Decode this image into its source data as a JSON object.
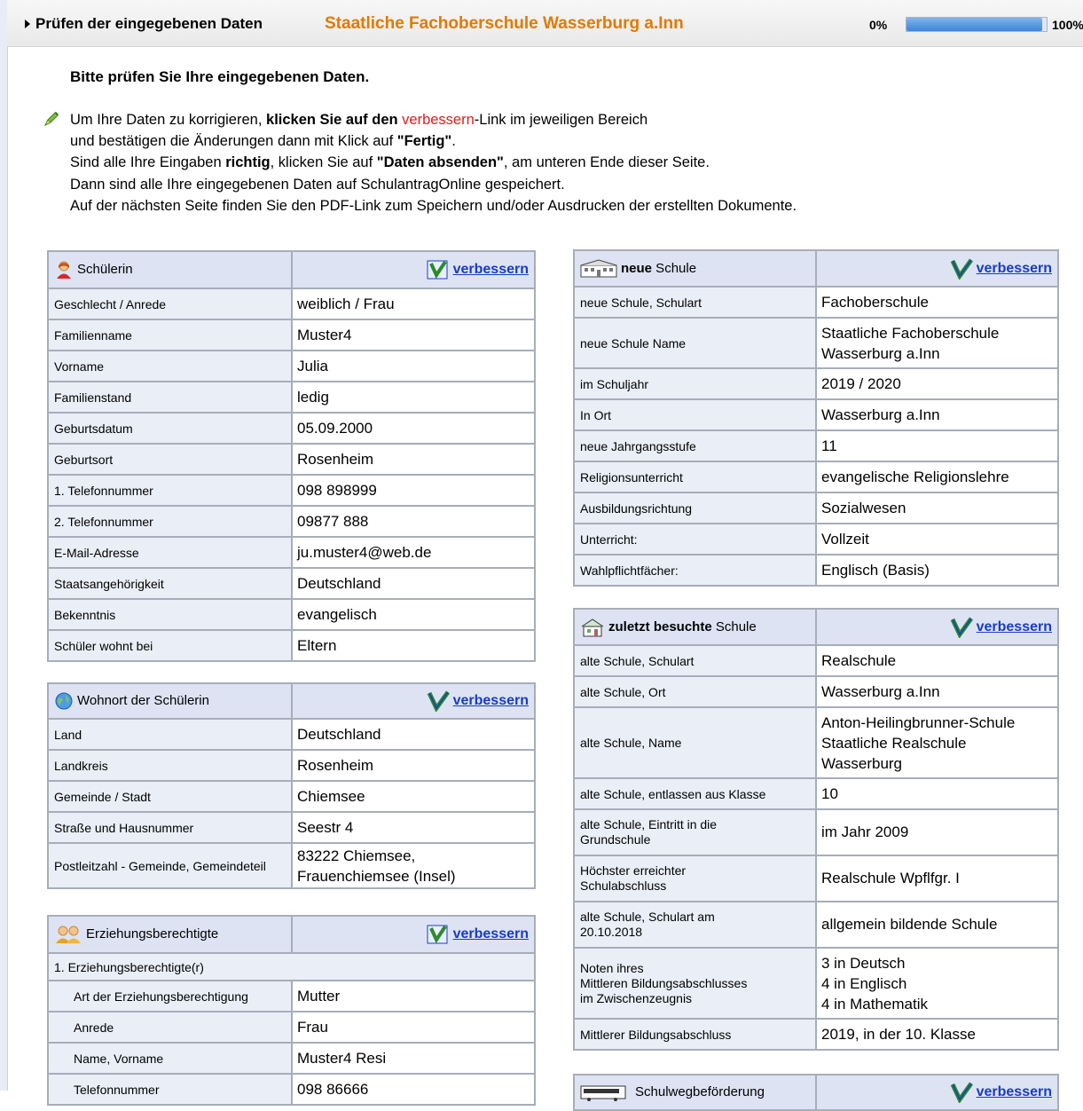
{
  "header": {
    "title": "Prüfen der eingegebenen Daten",
    "school": "Staatliche Fachoberschule Wasserburg a.Inn",
    "progress_start": "0%",
    "progress_end": "100%",
    "progress_fraction": 0.97
  },
  "intro": {
    "title": "Bitte prüfen Sie Ihre eingegebenen Daten.",
    "l1a": "Um Ihre Daten zu korrigieren, ",
    "l1b": "klicken Sie auf den ",
    "l1c": "verbessern",
    "l1d": "-Link im jeweiligen Bereich",
    "l2a": "und bestätigen die Änderungen dann mit Klick auf ",
    "l2b": "\"Fertig\"",
    "l2c": ".",
    "l3a": "Sind alle Ihre Eingaben ",
    "l3b": "richtig",
    "l3c": ", klicken Sie auf ",
    "l3d": "\"Daten absenden\"",
    "l3e": ", am unteren Ende dieser Seite.",
    "l4": "Dann sind alle Ihre eingegebenen Daten auf SchulantragOnline gespeichert.",
    "l5": "Auf der nächsten Seite finden Sie den PDF-Link zum Speichern und/oder Ausdrucken der erstellten Dokumente."
  },
  "edit_label": "verbessern",
  "student": {
    "title": "Schülerin",
    "rows": [
      {
        "label": "Geschlecht / Anrede",
        "value": "weiblich / Frau"
      },
      {
        "label": "Familienname",
        "value": "Muster4"
      },
      {
        "label": "Vorname",
        "value": "Julia"
      },
      {
        "label": "Familienstand",
        "value": "ledig"
      },
      {
        "label": "Geburtsdatum",
        "value": "05.09.2000"
      },
      {
        "label": "Geburtsort",
        "value": "Rosenheim"
      },
      {
        "label": "1. Telefonnummer",
        "value": "098 898999"
      },
      {
        "label": "2. Telefonnummer",
        "value": "09877 888"
      },
      {
        "label": "E-Mail-Adresse",
        "value": "ju.muster4@web.de"
      },
      {
        "label": "Staatsangehörigkeit",
        "value": "Deutschland"
      },
      {
        "label": "Bekenntnis",
        "value": "evangelisch"
      },
      {
        "label": "Schüler wohnt bei",
        "value": "Eltern"
      }
    ]
  },
  "residence": {
    "title": "Wohnort der Schülerin",
    "rows": [
      {
        "label": "Land",
        "value": "Deutschland"
      },
      {
        "label": "Landkreis",
        "value": "Rosenheim"
      },
      {
        "label": "Gemeinde / Stadt",
        "value": "Chiemsee"
      },
      {
        "label": "Straße und Hausnummer",
        "value": "Seestr 4"
      },
      {
        "label": "Postleitzahl - Gemeinde, Gemeindeteil",
        "value1": "83222 Chiemsee,",
        "value2": "Frauenchiemsee (Insel)"
      }
    ]
  },
  "guardians": {
    "title": "Erziehungsberechtigte",
    "subheading": "1. Erziehungsberechtigte(r)",
    "rows": [
      {
        "label": "Art der Erziehungsberechtigung",
        "value": "Mutter"
      },
      {
        "label": "Anrede",
        "value": "Frau"
      },
      {
        "label": "Name, Vorname",
        "value": "Muster4 Resi"
      },
      {
        "label": "Telefonnummer",
        "value": "098 86666"
      }
    ]
  },
  "new_school": {
    "title_bold": "neue",
    "title_rest": " Schule",
    "rows": [
      {
        "label": "neue Schule, Schulart",
        "value": "Fachoberschule"
      },
      {
        "label": "neue Schule Name",
        "value1": "Staatliche Fachoberschule",
        "value2": "Wasserburg a.Inn"
      },
      {
        "label": "im Schuljahr",
        "value": "2019 / 2020"
      },
      {
        "label": "In Ort",
        "value": "Wasserburg a.Inn"
      },
      {
        "label": "neue Jahrgangsstufe",
        "value": "11"
      },
      {
        "label": "Religionsunterricht",
        "value": "evangelische Religionslehre"
      },
      {
        "label": "Ausbildungsrichtung",
        "value": "Sozialwesen"
      },
      {
        "label": "Unterricht:",
        "value": "Vollzeit"
      },
      {
        "label": "Wahlpflichtfächer:",
        "value": "Englisch (Basis)"
      }
    ]
  },
  "last_school": {
    "title_bold": "zuletzt besuchte",
    "title_rest": " Schule",
    "rows": [
      {
        "label": "alte Schule, Schulart",
        "value": "Realschule"
      },
      {
        "label": "alte Schule, Ort",
        "value": "Wasserburg a.Inn"
      },
      {
        "label": "alte Schule, Name",
        "value1": "Anton-Heilingbrunner-Schule",
        "value2": "Staatliche Realschule",
        "value3": "Wasserburg"
      },
      {
        "label": "alte Schule, entlassen aus Klasse",
        "value": "10"
      },
      {
        "label1": "alte Schule, Eintritt in die",
        "label2": "Grundschule",
        "value": "im Jahr 2009"
      },
      {
        "label1": "Höchster erreichter",
        "label2": "Schulabschluss",
        "value": "Realschule Wpflfgr. I"
      },
      {
        "label1": "alte Schule, Schulart am",
        "label2": "20.10.2018",
        "value": "allgemein bildende Schule"
      },
      {
        "label1": "Noten ihres",
        "label2": "Mittleren Bildungsabschlusses",
        "label3": "im Zwischenzeugnis",
        "value1": "3 in Deutsch",
        "value2": "4 in Englisch",
        "value3": "4 in Mathematik"
      },
      {
        "label": "Mittlerer Bildungsabschluss",
        "value": "2019, in der 10. Klasse"
      }
    ]
  },
  "transport": {
    "title": "Schulwegbeförderung"
  },
  "colors": {
    "school_name": "#e07b00",
    "link": "#1a3cc0",
    "emphasis_red": "#e21b1b",
    "label_bg": "#eaeef7",
    "header_bg": "#dde3f3"
  },
  "icons": [
    "pencil-icon",
    "female-student-icon",
    "globe-icon",
    "parents-icon",
    "school-building-icon",
    "house-icon",
    "bus-icon",
    "edit-v-icon"
  ]
}
